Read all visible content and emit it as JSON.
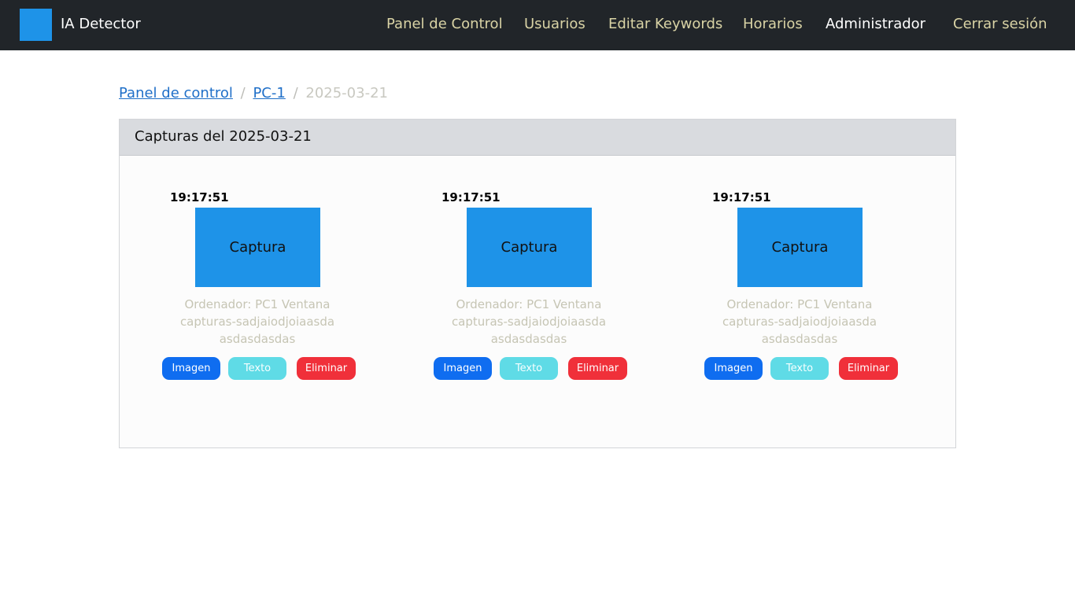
{
  "navbar": {
    "brand": "IA Detector",
    "links": [
      {
        "label": "Panel de Control"
      },
      {
        "label": "Usuarios"
      },
      {
        "label": "Editar Keywords"
      },
      {
        "label": "Horarios"
      },
      {
        "label": "Administrador"
      },
      {
        "label": "Cerrar sesión"
      }
    ]
  },
  "breadcrumb": {
    "items": [
      "Panel de control",
      "PC-1"
    ],
    "separator": "/",
    "current": "2025-03-21"
  },
  "card": {
    "title": "Capturas del 2025-03-21"
  },
  "captures": [
    {
      "time": "19:17:51",
      "thumb_label": "Captura",
      "description": "Ordenador: PC1 Ventana capturas-sadjaiodjoiaasda asdasdasdas",
      "buttons": {
        "image": "Imagen",
        "text": "Texto",
        "delete": "Eliminar"
      }
    },
    {
      "time": "19:17:51",
      "thumb_label": "Captura",
      "description": "Ordenador: PC1 Ventana capturas-sadjaiodjoiaasda asdasdasdas",
      "buttons": {
        "image": "Imagen",
        "text": "Texto",
        "delete": "Eliminar"
      }
    },
    {
      "time": "19:17:51",
      "thumb_label": "Captura",
      "description": "Ordenador: PC1 Ventana capturas-sadjaiodjoiaasda asdasdasdas",
      "buttons": {
        "image": "Imagen",
        "text": "Texto",
        "delete": "Eliminar"
      }
    }
  ],
  "colors": {
    "navbar_bg": "#212529",
    "accent": "#1e93e8",
    "button_image": "#0f6df0",
    "button_text": "#5fdbe6",
    "button_delete": "#f0303a"
  }
}
